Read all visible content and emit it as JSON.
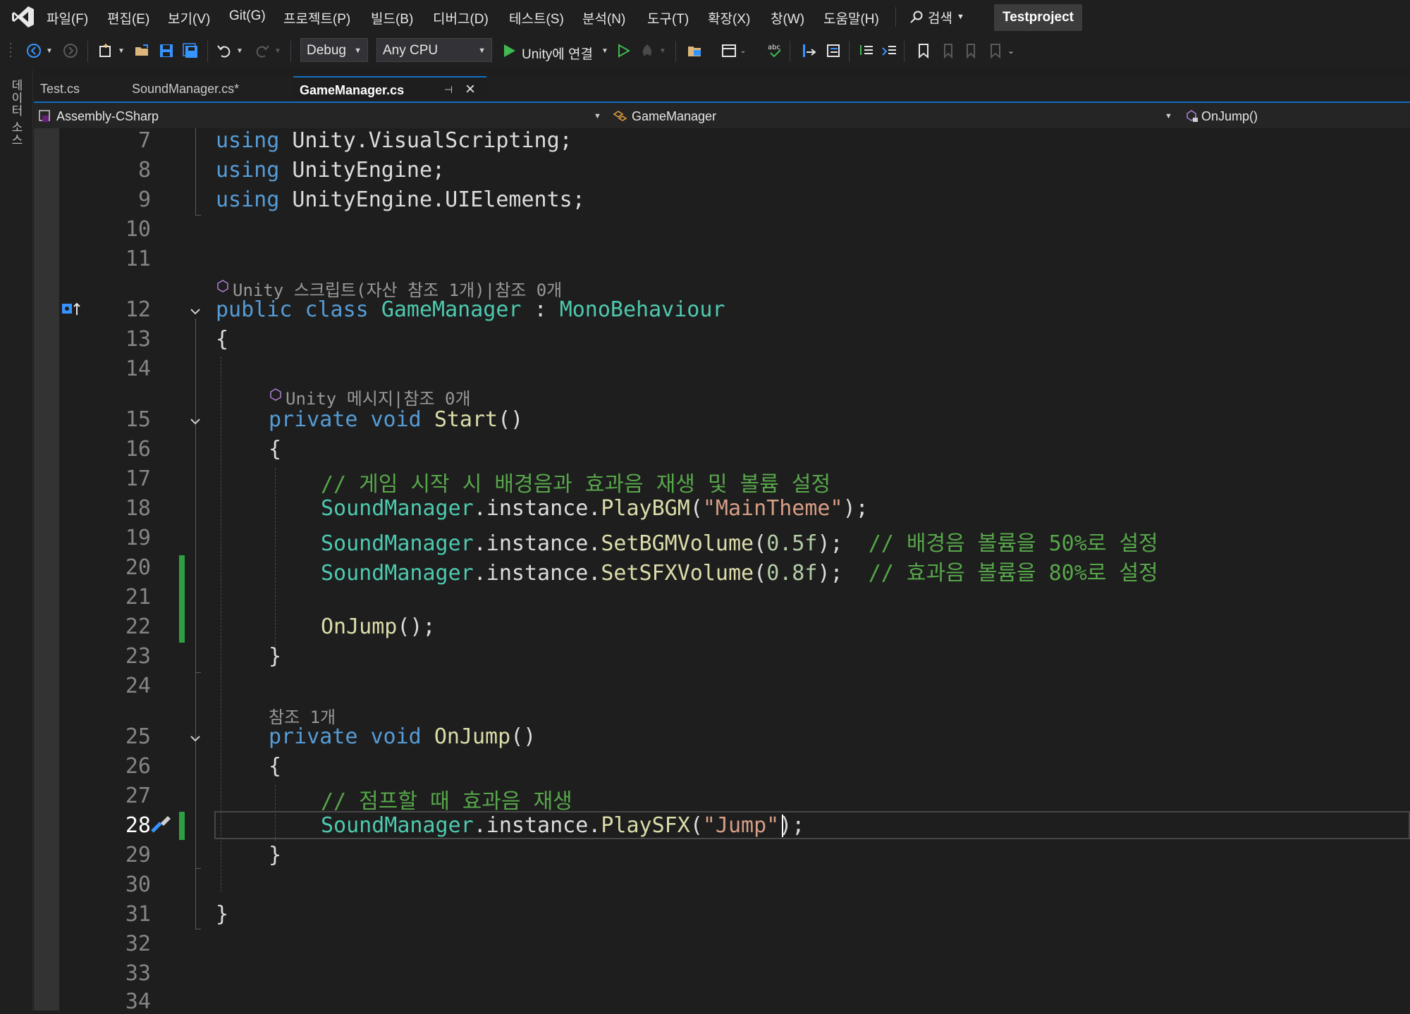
{
  "menubar": {
    "items": [
      "파일(F)",
      "편집(E)",
      "보기(V)",
      "Git(G)",
      "프로젝트(P)",
      "빌드(B)",
      "디버그(D)",
      "테스트(S)",
      "분석(N)",
      "도구(T)",
      "확장(X)",
      "창(W)",
      "도움말(H)"
    ],
    "search_label": "검색",
    "project_name": "Testproject"
  },
  "toolbar": {
    "config": "Debug",
    "platform": "Any CPU",
    "run_label": "Unity에 연결"
  },
  "left_strip": {
    "label": "데이터 소스"
  },
  "tabs": [
    {
      "label": "Test.cs"
    },
    {
      "label": "SoundManager.cs*"
    },
    {
      "label": "GameManager.cs"
    }
  ],
  "navbar": {
    "project": "Assembly-CSharp",
    "type": "GameManager",
    "member": "OnJump()"
  },
  "codelens": {
    "class_lens": "Unity 스크립트(자산 참조 1개)|참조 0개",
    "start_lens": "Unity 메시지|참조 0개",
    "onjump_lens": "참조 1개"
  },
  "line_numbers": [
    "7",
    "8",
    "9",
    "10",
    "11",
    "12",
    "13",
    "14",
    "15",
    "16",
    "17",
    "18",
    "19",
    "20",
    "21",
    "22",
    "23",
    "24",
    "25",
    "26",
    "27",
    "28",
    "29",
    "30",
    "31",
    "32",
    "33",
    "34"
  ],
  "code": {
    "l7": [
      "using",
      "Unity.VisualScripting;"
    ],
    "l8": [
      "using",
      "UnityEngine;"
    ],
    "l9": [
      "using",
      "UnityEngine.UIElements;"
    ],
    "l12": [
      "public",
      "class",
      "GameManager",
      ":",
      "MonoBehaviour"
    ],
    "l13": "{",
    "l15": [
      "private",
      "void",
      "Start",
      "()"
    ],
    "l16": "{",
    "l17": "// 게임 시작 시 배경음과 효과음 재생 및 볼륨 설정",
    "l18": [
      "SoundManager",
      ".instance.",
      "PlayBGM",
      "(",
      "\"MainTheme\"",
      ");"
    ],
    "l19": [
      "SoundManager",
      ".instance.",
      "SetBGMVolume",
      "(",
      "0.5f",
      ");  ",
      "// 배경음 볼륨을 50%로 설정"
    ],
    "l20": [
      "SoundManager",
      ".instance.",
      "SetSFXVolume",
      "(",
      "0.8f",
      ");  ",
      "// 효과음 볼륨을 80%로 설정"
    ],
    "l22": [
      "OnJump",
      "();"
    ],
    "l23": "}",
    "l25": [
      "private",
      "void",
      "OnJump",
      "()"
    ],
    "l26": "{",
    "l27": "// 점프할 때 효과음 재생",
    "l28": [
      "SoundManager",
      ".instance.",
      "PlaySFX",
      "(",
      "\"Jump\"",
      ");"
    ],
    "l29": "}",
    "l31": "}"
  }
}
